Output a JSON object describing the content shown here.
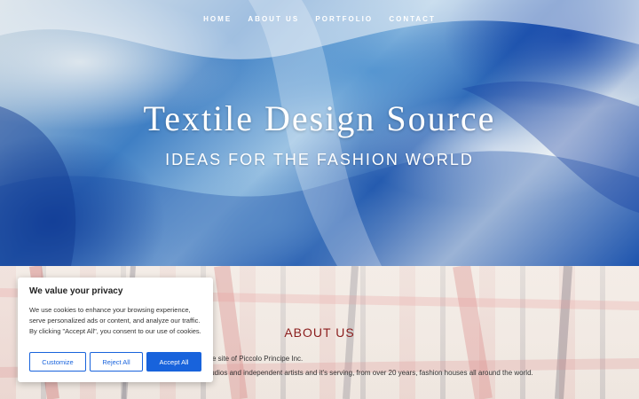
{
  "nav": {
    "items": [
      "HOME",
      "ABOUT US",
      "PORTFOLIO",
      "CONTACT"
    ]
  },
  "hero": {
    "title": "Textile Design Source",
    "subtitle": "IDEAS FOR THE FASHION WORLD"
  },
  "about": {
    "heading": "ABOUT US",
    "line1": "ve site of Piccolo Principe Inc.",
    "line2": "tudios and independent artists and it's serving,  from over 20 years, fashion houses all around the world."
  },
  "cookie": {
    "title": "We value your privacy",
    "text": "We use cookies to enhance your browsing experience, serve personalized ads or content, and analyze our traffic. By clicking \"Accept All\", you consent to our use of cookies.",
    "customize_label": "Customize",
    "reject_label": "Reject All",
    "accept_label": "Accept All"
  },
  "colors": {
    "accent": "#1863dc",
    "heading": "#8b1d1d"
  }
}
